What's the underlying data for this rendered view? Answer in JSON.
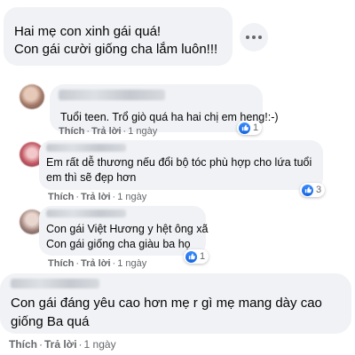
{
  "comments": [
    {
      "lines": [
        "Hai mẹ con xinh gái quá!",
        "Con gái cười giống cha lắm luôn!!!"
      ]
    },
    {
      "text": "Tuổi teen. Trổ giò quá ha hai chị em heng!:-)",
      "reaction_count": "1",
      "action_like": "Thích",
      "action_reply": "Trả lời",
      "age": "1 ngày"
    },
    {
      "lines": [
        "Em rất dễ thương nếu đổi bộ tóc phù hợp cho lứa tuổi",
        "em thì sẽ đẹp hơn"
      ],
      "reaction_count": "3",
      "action_like": "Thích",
      "action_reply": "Trả lời",
      "age": "1 ngày"
    },
    {
      "lines": [
        "Con gái Việt Hương y hệt ông xã",
        "Con gái giống cha giàu ba họ"
      ],
      "reaction_count": "1",
      "action_like": "Thích",
      "action_reply": "Trả lời",
      "age": "1 ngày"
    },
    {
      "lines": [
        "Con gái đáng yêu cao hơn mẹ r gì mẹ mang dày cao",
        "giống Ba quá"
      ],
      "action_like": "Thích",
      "action_reply": "Trả lời",
      "age": "1 ngày"
    }
  ],
  "colors": {
    "bubble": "#f0f2f5",
    "meta_text": "#65676b",
    "like_blue": "#1877f2"
  },
  "icons": {
    "more": "more-options-icon",
    "like": "like-thumb-icon"
  }
}
